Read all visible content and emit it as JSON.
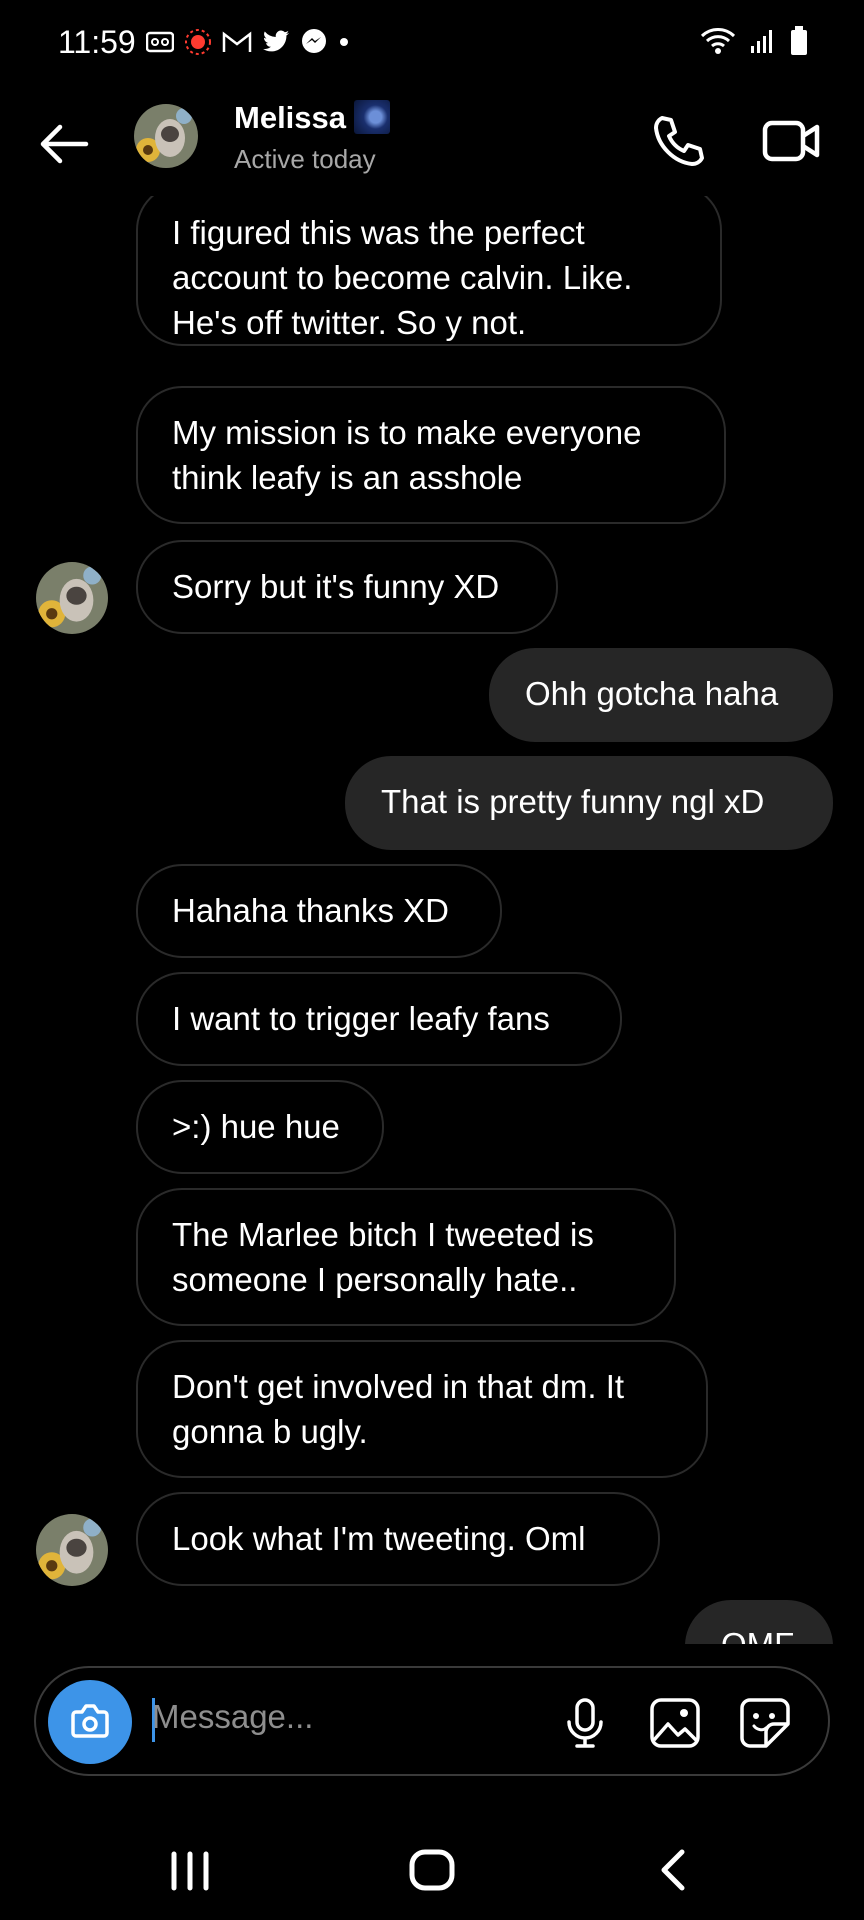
{
  "status_bar": {
    "time": "11:59",
    "icons_left": [
      "voicemail-icon",
      "recording-icon",
      "gmail-icon",
      "twitter-icon",
      "messenger-icon",
      "dot-icon"
    ],
    "icons_right": [
      "wifi-icon",
      "signal-icon",
      "battery-icon"
    ]
  },
  "header": {
    "name": "Melissa",
    "status": "Active today"
  },
  "messages": [
    {
      "side": "in",
      "lines": [
        "I figured this was the perfect",
        "account to become calvin. Like.",
        "He's off twitter. So y not."
      ]
    },
    {
      "side": "in",
      "lines": [
        "My mission is to make everyone",
        "think leafy is an asshole"
      ]
    },
    {
      "side": "in",
      "lines": [
        "Sorry but it's funny XD"
      ]
    },
    {
      "side": "out",
      "lines": [
        "Ohh gotcha haha"
      ]
    },
    {
      "side": "out",
      "lines": [
        "That is pretty funny ngl xD"
      ]
    },
    {
      "side": "in",
      "lines": [
        "Hahaha thanks XD"
      ]
    },
    {
      "side": "in",
      "lines": [
        "I want to trigger leafy fans"
      ]
    },
    {
      "side": "in",
      "lines": [
        ">:) hue hue"
      ]
    },
    {
      "side": "in",
      "lines": [
        "The Marlee bitch I tweeted is",
        "someone I personally hate.."
      ]
    },
    {
      "side": "in",
      "lines": [
        "Don't get involved in that dm. It",
        "gonna b ugly."
      ]
    },
    {
      "side": "in",
      "lines": [
        "Look what I'm tweeting. Oml"
      ]
    },
    {
      "side": "out",
      "lines": [
        "OMF"
      ]
    }
  ],
  "composer": {
    "placeholder": "Message..."
  },
  "colors": {
    "accent": "#3d94e8",
    "bubble_out": "#262626",
    "bubble_in_border": "#2a2a2a"
  }
}
